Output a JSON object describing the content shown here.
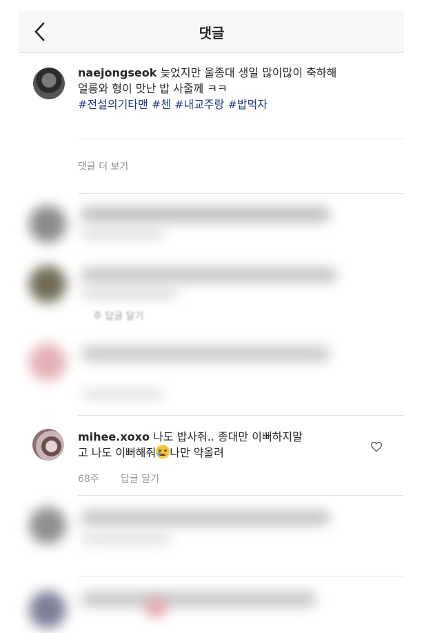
{
  "header": {
    "back_icon": "chevron-left-icon",
    "title": "댓글"
  },
  "caption": {
    "username": "naejongseok",
    "text_line1": " 늦었지만 울종대 생일 많이많이 축하해",
    "text_line2": "얼릉와 형이 맛난 밥 사줄께 ㅋㅋ",
    "hashtags": [
      "#전설의기타맨",
      "#첸",
      "#내교주랑",
      "#밥먹자"
    ]
  },
  "view_more_label": "댓글 더 보기",
  "blurred_meta": "주 답글 달기",
  "comment": {
    "username": "mihee.xoxo",
    "text_line1": " 나도 밥사줘.. 종대만 이뻐하지말",
    "text_line2_before": "고 나도 이뻐해줘",
    "emoji": "crying-face-emoji",
    "text_line2_after": "나만 약올려",
    "time": "68주",
    "reply_label": "답글 달기",
    "like_icon": "heart-outline-icon"
  },
  "colors": {
    "hashtag": "#1f3b7d",
    "meta": "#999999",
    "divider": "#e3e3e3",
    "header_bg": "#f7f7f7"
  }
}
